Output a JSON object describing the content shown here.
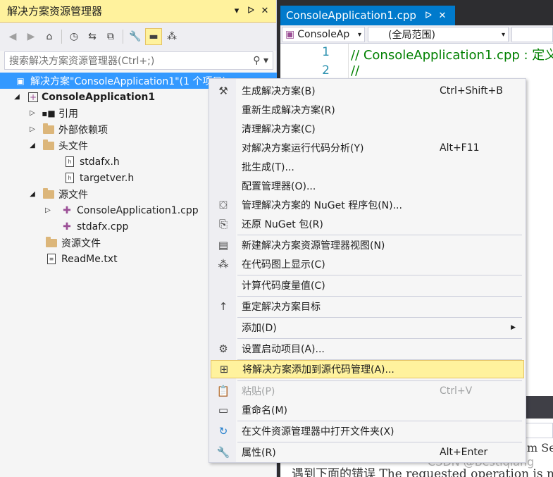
{
  "solution_explorer": {
    "title": "解决方案资源管理器",
    "title_buttons": [
      "▾",
      "ᐅ",
      "✕"
    ],
    "search_placeholder": "搜索解决方案资源管理器(Ctrl+;)",
    "tree": [
      {
        "label": "解决方案\"ConsoleApplication1\"(1 个项目)",
        "selected": true
      },
      {
        "label": "ConsoleApplication1"
      },
      {
        "label": "引用"
      },
      {
        "label": "外部依赖项"
      },
      {
        "label": "头文件"
      },
      {
        "label": "stdafx.h"
      },
      {
        "label": "targetver.h"
      },
      {
        "label": "源文件"
      },
      {
        "label": "ConsoleApplication1.cpp"
      },
      {
        "label": "stdafx.cpp"
      },
      {
        "label": "资源文件"
      },
      {
        "label": "ReadMe.txt"
      }
    ]
  },
  "editor": {
    "tab_label": "ConsoleApplication1.cpp",
    "nav_project": "ConsoleAp",
    "nav_scope": "(全局范围)",
    "lines": [
      {
        "num": "1",
        "text": "// ConsoleApplication1.cpp : 定义"
      },
      {
        "num": "2",
        "text": "//"
      }
    ],
    "lower_text_1": "m Ser",
    "lower_text_2": "遇到下面的错误  The requested operation is not"
  },
  "watermark": "CSDN @Bestlqiang",
  "context_menu": {
    "items": [
      {
        "label": "生成解决方案(B)",
        "shortcut": "Ctrl+Shift+B",
        "icon": "build-icon"
      },
      {
        "label": "重新生成解决方案(R)",
        "shortcut": ""
      },
      {
        "label": "清理解决方案(C)",
        "shortcut": ""
      },
      {
        "label": "对解决方案运行代码分析(Y)",
        "shortcut": "Alt+F11"
      },
      {
        "label": "批生成(T)...",
        "shortcut": ""
      },
      {
        "label": "配置管理器(O)...",
        "shortcut": ""
      },
      {
        "label": "管理解决方案的 NuGet 程序包(N)...",
        "shortcut": "",
        "icon": "nuget-package-icon"
      },
      {
        "label": "还原 NuGet 包(R)",
        "shortcut": "",
        "icon": "restore-icon"
      },
      {
        "label": "新建解决方案资源管理器视图(N)",
        "shortcut": "",
        "icon": "new-view-icon"
      },
      {
        "label": "在代码图上显示(C)",
        "shortcut": "",
        "icon": "code-map-icon"
      },
      {
        "label": "计算代码度量值(C)",
        "shortcut": ""
      },
      {
        "label": "重定解决方案目标",
        "shortcut": "",
        "icon": "retarget-icon"
      },
      {
        "label": "添加(D)",
        "shortcut": ""
      },
      {
        "label": "设置启动项目(A)...",
        "shortcut": "",
        "icon": "gear-icon"
      },
      {
        "label": "将解决方案添加到源代码管理(A)...",
        "shortcut": "",
        "icon": "add-source-control-icon",
        "highlighted": true
      },
      {
        "label": "粘贴(P)",
        "shortcut": "Ctrl+V",
        "icon": "paste-icon",
        "disabled": true
      },
      {
        "label": "重命名(M)",
        "shortcut": "",
        "icon": "rename-icon"
      },
      {
        "label": "在文件资源管理器中打开文件夹(X)",
        "shortcut": "",
        "icon": "refresh-icon"
      },
      {
        "label": "属性(R)",
        "shortcut": "Alt+Enter",
        "icon": "wrench-icon"
      }
    ]
  }
}
